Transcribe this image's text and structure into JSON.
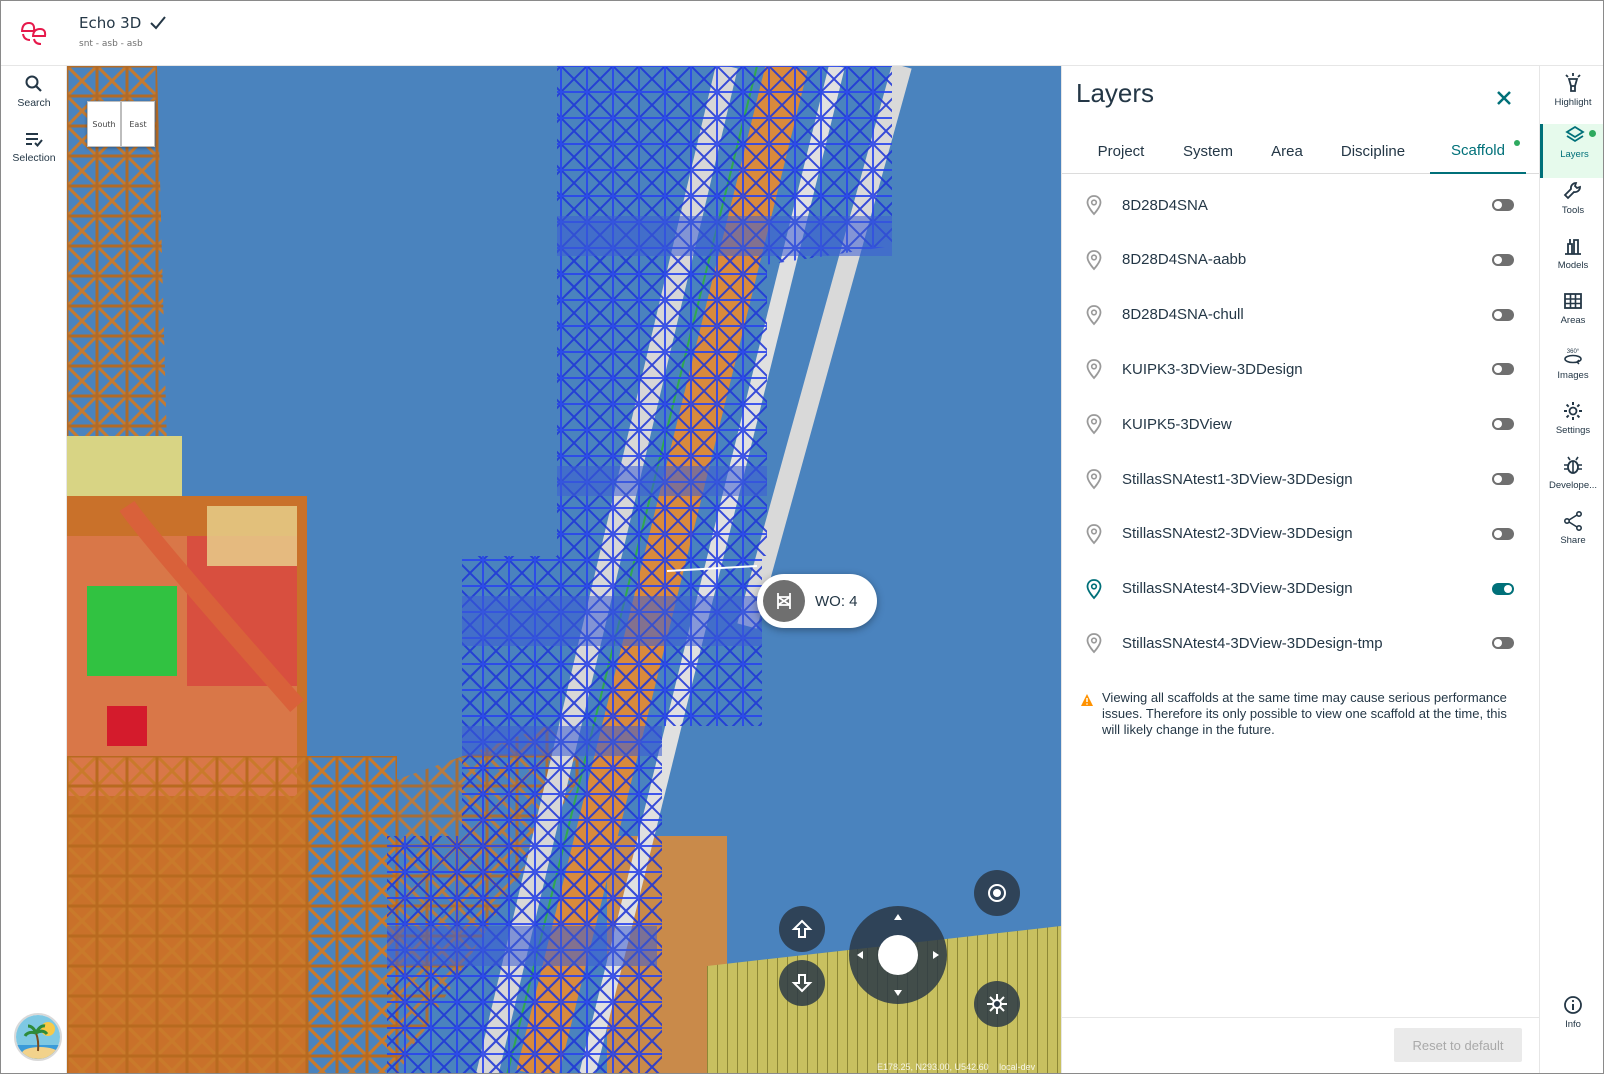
{
  "header": {
    "title": "Echo 3D",
    "subtitle": "snt - asb - asb"
  },
  "left_rail": [
    {
      "label": "Search",
      "icon": "search-icon"
    },
    {
      "label": "Selection",
      "icon": "selection-icon"
    }
  ],
  "viewport": {
    "view_cube": {
      "face_left": "South",
      "face_right": "East"
    },
    "wo_badge": "WO: 4",
    "coords": "E178.25, N293.00, U542.60",
    "env": "local-dev"
  },
  "panel": {
    "title": "Layers",
    "tabs": [
      {
        "label": "Project"
      },
      {
        "label": "System"
      },
      {
        "label": "Area"
      },
      {
        "label": "Discipline"
      },
      {
        "label": "Scaffold",
        "active": true
      }
    ],
    "layers": [
      {
        "name": "8D28D4SNA",
        "enabled": false
      },
      {
        "name": "8D28D4SNA-aabb",
        "enabled": false
      },
      {
        "name": "8D28D4SNA-chull",
        "enabled": false
      },
      {
        "name": "KUIPK3-3DView-3DDesign",
        "enabled": false
      },
      {
        "name": "KUIPK5-3DView",
        "enabled": false
      },
      {
        "name": "StillasSNAtest1-3DView-3DDesign",
        "enabled": false
      },
      {
        "name": "StillasSNAtest2-3DView-3DDesign",
        "enabled": false
      },
      {
        "name": "StillasSNAtest4-3DView-3DDesign",
        "enabled": true
      },
      {
        "name": "StillasSNAtest4-3DView-3DDesign-tmp",
        "enabled": false
      }
    ],
    "warning": "Viewing all scaffolds at the same time may cause serious performance issues. Therefore its only possible to view one scaffold at the time, this will likely change in the future.",
    "reset_label": "Reset to default"
  },
  "right_rail": [
    {
      "label": "Highlight",
      "icon": "highlight-icon"
    },
    {
      "label": "Layers",
      "icon": "layers-icon",
      "active": true
    },
    {
      "label": "Tools",
      "icon": "tools-icon"
    },
    {
      "label": "Models",
      "icon": "models-icon"
    },
    {
      "label": "Areas",
      "icon": "areas-icon"
    },
    {
      "label": "Images",
      "icon": "images-360-icon"
    },
    {
      "label": "Settings",
      "icon": "settings-icon"
    },
    {
      "label": "Develope...",
      "icon": "developer-icon"
    },
    {
      "label": "Share",
      "icon": "share-icon"
    },
    {
      "label": "Info",
      "icon": "info-icon"
    }
  ],
  "colors": {
    "accent": "#007079",
    "active_dot": "#2eaa5f",
    "sky": "#4f86bf",
    "scaffold": "#2a3fd6",
    "pipe": "#d98a3c"
  }
}
